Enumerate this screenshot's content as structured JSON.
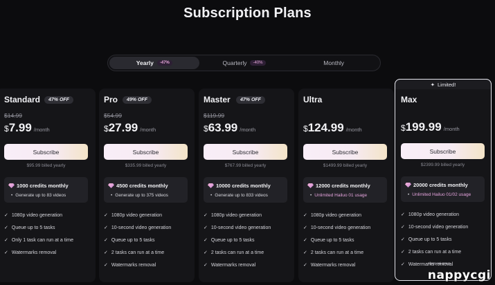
{
  "page": {
    "title": "Subscription Plans"
  },
  "period_toggle": {
    "tabs": [
      {
        "label": "Yearly",
        "badge": "-47%"
      },
      {
        "label": "Quarterly",
        "badge": "-40%"
      },
      {
        "label": "Monthly",
        "badge": ""
      }
    ],
    "selected": "Yearly"
  },
  "plans": [
    {
      "name": "Standard",
      "off": "47% OFF",
      "old_price": "$14.99",
      "currency": "$",
      "price": "7.99",
      "per": "/month",
      "subscribe": "Subscribe",
      "billed": "$95.99 billed yearly",
      "credits": "1000 credits monthly",
      "credits_sub": "Generate up to 83 videos",
      "features": [
        "1080p video generation",
        "Queue up to 5 tasks",
        "Only 1 task can run at a time",
        "Watermarks removal"
      ]
    },
    {
      "name": "Pro",
      "off": "49% OFF",
      "old_price": "$54.99",
      "currency": "$",
      "price": "27.99",
      "per": "/month",
      "subscribe": "Subscribe",
      "billed": "$335.99 billed yearly",
      "credits": "4500 credits monthly",
      "credits_sub": "Generate up to 375 videos",
      "features": [
        "1080p video generation",
        "10-second video generation",
        "Queue up to 5 tasks",
        "2 tasks can run at a time",
        "Watermarks removal"
      ]
    },
    {
      "name": "Master",
      "off": "47% OFF",
      "old_price": "$119.99",
      "currency": "$",
      "price": "63.99",
      "per": "/month",
      "subscribe": "Subscribe",
      "billed": "$767.99 billed yearly",
      "credits": "10000 credits monthly",
      "credits_sub": "Generate up to 833 videos",
      "features": [
        "1080p video generation",
        "10-second video generation",
        "Queue up to 5 tasks",
        "2 tasks can run at a time",
        "Watermarks removal"
      ]
    },
    {
      "name": "Ultra",
      "off": "",
      "old_price": "",
      "currency": "$",
      "price": "124.99",
      "per": "/month",
      "subscribe": "Subscribe",
      "billed": "$1499.99 billed yearly",
      "credits": "12000 credits monthly",
      "credits_sub": "Unlimited Hailuo 01 usage",
      "features": [
        "1080p video generation",
        "10-second video generation",
        "Queue up to 5 tasks",
        "2 tasks can run at a time",
        "Watermarks removal"
      ]
    },
    {
      "name": "Max",
      "off": "",
      "old_price": "",
      "currency": "$",
      "price": "199.99",
      "per": "/month",
      "tag": "Limited!",
      "subscribe": "Subscribe",
      "billed": "$2399.99 billed yearly",
      "credits": "20000 credits monthly",
      "credits_sub": "Unlimited Hailuo 01/02 usage",
      "features": [
        "1080p video generation",
        "10-second video generation",
        "Queue up to 5 tasks",
        "2 tasks can run at a time",
        "Watermarks removal"
      ]
    }
  ],
  "watermark": {
    "text": "nappycgi",
    "small": "nappy cgi group"
  },
  "colors": {
    "background": "#0c0c0e",
    "card": "#151518",
    "accent_pink": "#e7a5df",
    "subscribe_gradient_start": "#f9eef8",
    "subscribe_gradient_end": "#f4e4c8"
  },
  "icons": {
    "sparkle": "sparkle-icon",
    "gem": "gem-icon",
    "check": "check-icon"
  }
}
